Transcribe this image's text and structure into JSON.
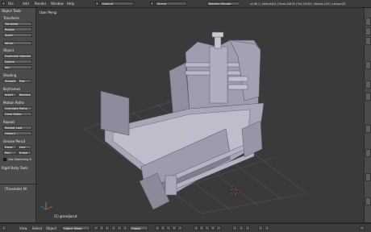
{
  "header": {
    "menus": [
      "File",
      "Add",
      "Render",
      "Window",
      "Help"
    ],
    "layout": "Default",
    "scene": "Scene",
    "engine": "Blender Render",
    "stats": "v2.66.1 | Verts:6404 | Faces:18476 | Tris:12436 | Objects:1/50 | Lamps:0/0"
  },
  "toolshelf": {
    "title": "Object Tools",
    "sections": [
      {
        "label": "Transform",
        "buttons": [
          "Translate",
          "Rotate",
          "Scale",
          "Mirror"
        ]
      },
      {
        "label": "Object",
        "buttons": [
          "Duplicate Objects",
          "Delete",
          "Join"
        ]
      },
      {
        "label": "Shading",
        "pairs": [
          [
            "Smooth",
            "Flat"
          ]
        ]
      },
      {
        "label": "Keyframes",
        "pairs": [
          [
            "Insert",
            "Remove"
          ]
        ]
      },
      {
        "label": "Motion Paths",
        "buttons": [
          "Calculate Paths",
          "Clear Paths"
        ]
      },
      {
        "label": "Repeat",
        "buttons": [
          "Repeat Last",
          "History..."
        ]
      },
      {
        "label": "Grease Pencil",
        "pairs": [
          [
            "Draw",
            "Line"
          ],
          [
            "Poly",
            "Erase"
          ]
        ]
      },
      {
        "label": "",
        "buttons": [
          "Use Sketching S"
        ]
      }
    ],
    "rigid_body": "Rigid Body Tools",
    "operator": "(Translate) All"
  },
  "viewport": {
    "label": "User Persp",
    "object": "(1) grandjocut"
  },
  "footer": {
    "view": "View",
    "select": "Select",
    "object": "Object",
    "mode": "Object Mode",
    "pivot": "Global"
  },
  "colors": {
    "model": "#a7a7b8",
    "model_shadow": "#8c8c9c",
    "grid": "#545454",
    "viewport_bg": "#3a3a3a"
  }
}
